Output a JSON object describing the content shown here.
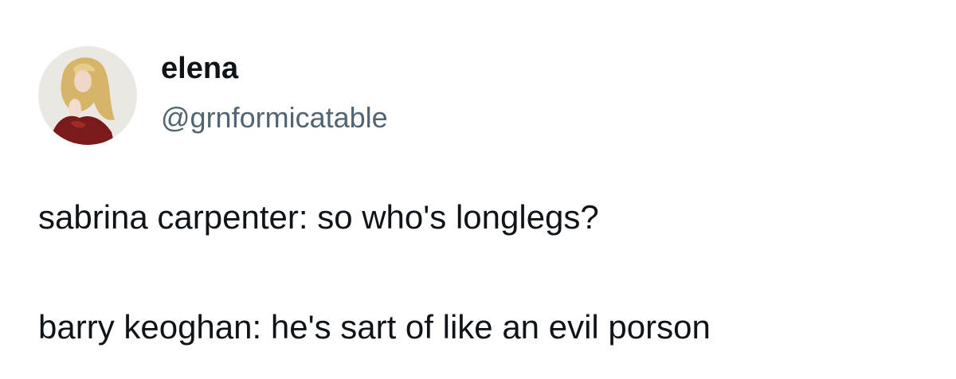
{
  "author": {
    "display_name": "elena",
    "handle": "@grnformicatable",
    "avatar_icon": "profile-photo-avatar"
  },
  "tweet": {
    "lines": [
      "sabrina carpenter: so who's longlegs?",
      "barry keoghan: he's sart of like an evil porson"
    ]
  },
  "colors": {
    "text_primary": "#0f1419",
    "text_secondary": "#536471",
    "background": "#ffffff"
  }
}
